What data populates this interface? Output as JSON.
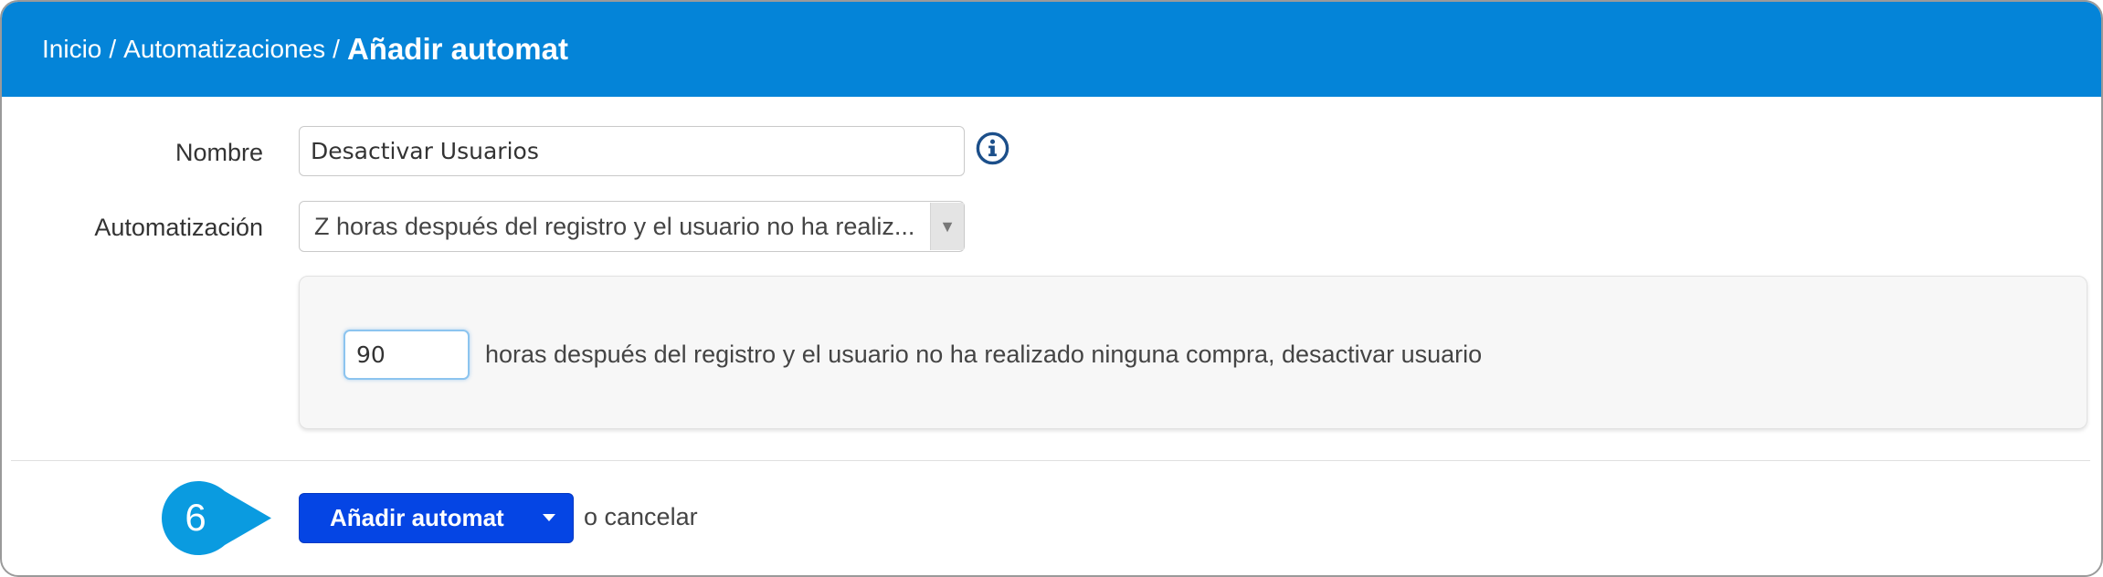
{
  "breadcrumb": {
    "home": "Inicio",
    "separator": "/",
    "section": "Automatizaciones",
    "current": "Añadir automat"
  },
  "form": {
    "name_label": "Nombre",
    "name_value": "Desactivar Usuarios",
    "automation_label": "Automatización",
    "automation_selected": "Z horas después del registro y el usuario no ha realiz...",
    "hours_value": "90",
    "hours_description": "horas después del registro y el usuario no ha realizado ninguna compra, desactivar usuario"
  },
  "actions": {
    "submit_label": "Añadir automat",
    "cancel_text": "o cancelar"
  },
  "step_badge": {
    "number": "6"
  },
  "icons": {
    "info": "info-icon",
    "select_arrow": "triangle-down-icon",
    "submit_caret": "caret-down-icon"
  },
  "colors": {
    "header": "#0484d8",
    "primary_button": "#0545e4",
    "badge": "#0a9be0",
    "info_icon": "#1c4f8a"
  }
}
